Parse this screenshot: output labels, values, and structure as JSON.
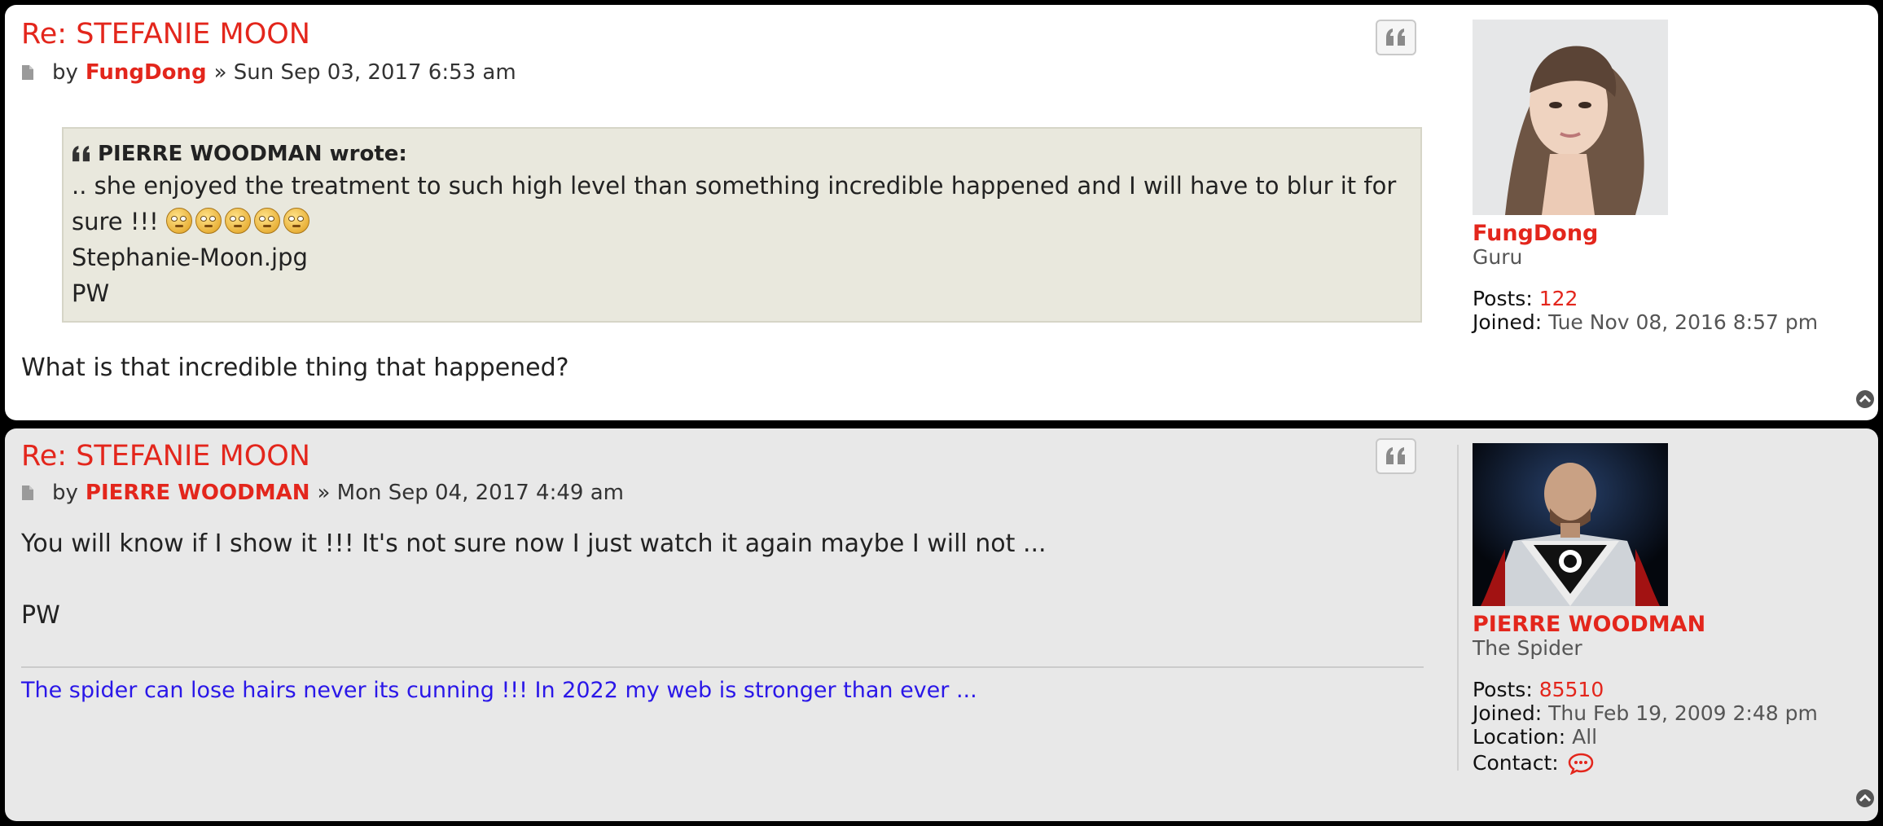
{
  "posts": [
    {
      "title": "Re: STEFANIE MOON",
      "by": "by",
      "author": "FungDong",
      "date": "» Sun Sep 03, 2017 6:53 am",
      "quote": {
        "header": "PIERRE WOODMAN wrote:",
        "line1": ".. she enjoyed the treatment to such high level than something incredible happened and I will have to blur it for",
        "line2": "sure !!!",
        "emoji_name": "rolling-eyes-emoji",
        "emoji_count": 5,
        "file": "Stephanie-Moon.jpg",
        "sign": "PW"
      },
      "body": "What is that incredible thing that happened?",
      "profile": {
        "username": "FungDong",
        "rank": "Guru",
        "posts_label": "Posts:",
        "posts": "122",
        "joined_label": "Joined:",
        "joined": "Tue Nov 08, 2016 8:57 pm"
      }
    },
    {
      "title": "Re: STEFANIE MOON",
      "by": "by",
      "author": "PIERRE WOODMAN",
      "date": "» Mon Sep 04, 2017 4:49 am",
      "body_line1": "You will know if I show it !!! It's not sure now I just watch it again maybe I will not ...",
      "body_line2": "PW",
      "signature": "The spider can lose hairs never its cunning !!! In 2022 my web is stronger than ever ...",
      "profile": {
        "username": "PIERRE WOODMAN",
        "rank": "The Spider",
        "posts_label": "Posts:",
        "posts": "85510",
        "joined_label": "Joined:",
        "joined": "Thu Feb 19, 2009 2:48 pm",
        "location_label": "Location:",
        "location": "All",
        "contact_label": "Contact:"
      }
    }
  ],
  "colors": {
    "accent": "#e3261c",
    "signature": "#2a17e8",
    "quote_bg": "#e9e8dd",
    "post_alt_bg": "#e8e8e8"
  },
  "icons": [
    "document-icon",
    "quote-icon",
    "chat-bubble-icon",
    "back-to-top-icon"
  ]
}
